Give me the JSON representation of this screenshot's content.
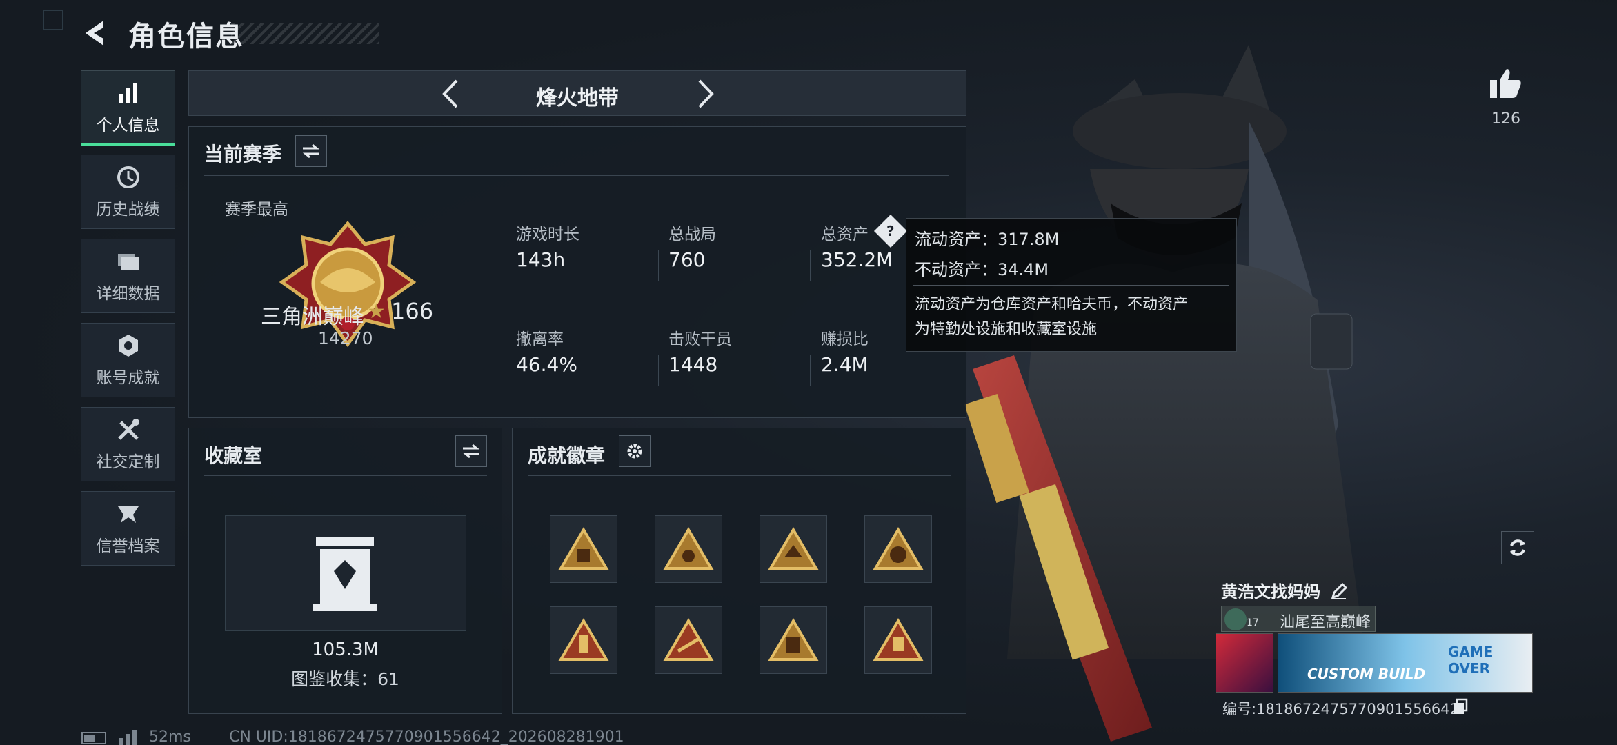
{
  "header": {
    "title": "角色信息"
  },
  "sidebar": {
    "items": [
      {
        "label": "个人信息",
        "icon": "bar-chart-icon",
        "active": true
      },
      {
        "label": "历史战绩",
        "icon": "history-clock-icon"
      },
      {
        "label": "详细数据",
        "icon": "folder-icon"
      },
      {
        "label": "账号成就",
        "icon": "achievement-icon"
      },
      {
        "label": "社交定制",
        "icon": "tools-icon"
      },
      {
        "label": "信誉档案",
        "icon": "credit-icon"
      }
    ]
  },
  "mode": {
    "label": "烽火地带"
  },
  "season": {
    "title": "当前赛季",
    "best_label": "赛季最高",
    "rank_name": "三角洲巅峰",
    "rank_stars": "166",
    "rank_score": "14270",
    "stats": [
      {
        "label": "游戏时长",
        "value": "143h"
      },
      {
        "label": "总战局",
        "value": "760"
      },
      {
        "label": "总资产",
        "value": "352.2M"
      },
      {
        "label": "撤离率",
        "value": "46.4%"
      },
      {
        "label": "击败干员",
        "value": "1448"
      },
      {
        "label": "赚损比",
        "value": "2.4M"
      }
    ]
  },
  "tooltip": {
    "liquid": "流动资产：317.8M",
    "fixed": "不动资产：34.4M",
    "note_line1": "流动资产为仓库资产和哈夫币，不动资产",
    "note_line2": "为特勤处设施和收藏室设施"
  },
  "collection": {
    "title": "收藏室",
    "value": "105.3M",
    "catalog": "图鉴收集：61"
  },
  "achievements": {
    "title": "成就徽章",
    "badge_count": 8
  },
  "likes": {
    "count": "126"
  },
  "player": {
    "name": "黄浩文找妈妈",
    "tag_level": "17",
    "tag_title": "汕尾至高巅峰",
    "card_text": "GAME OVER",
    "card_text2": "CUSTOM BUILD",
    "id_line": "编号:1818672475770901556642"
  },
  "footer": {
    "ping": "52ms",
    "uid": "CN UID:1818672475770901556642_202608281901"
  },
  "colors": {
    "accent": "#4ade9a",
    "gold": "#c9a24a",
    "panel": "#161d25"
  }
}
